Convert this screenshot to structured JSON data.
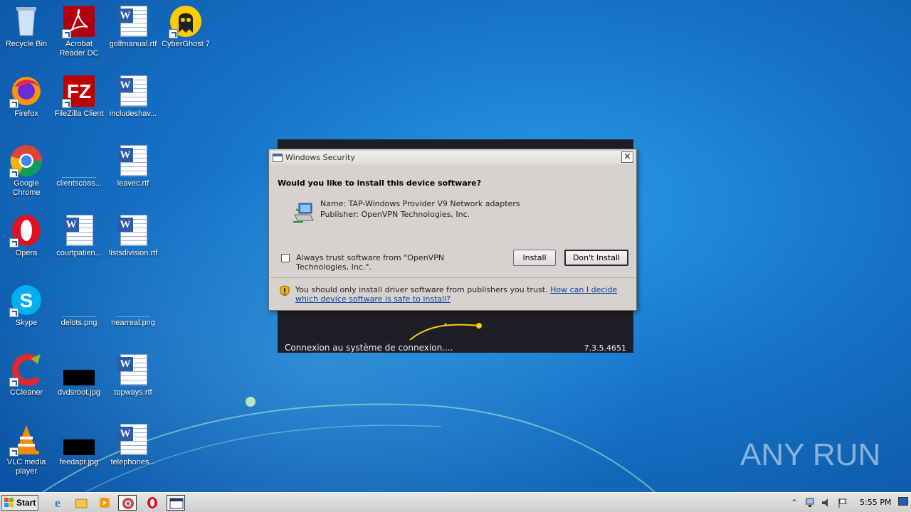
{
  "desktop_icons": [
    {
      "label": "Recycle Bin",
      "icon": "recycle-bin-icon"
    },
    {
      "label": "Acrobat Reader DC",
      "icon": "acrobat-icon"
    },
    {
      "label": "golfmanual.rtf",
      "icon": "word-document-icon"
    },
    {
      "label": "CyberGhost 7",
      "icon": "cyberghost-icon"
    },
    {
      "label": "Firefox",
      "icon": "firefox-icon"
    },
    {
      "label": "FileZilla Client",
      "icon": "filezilla-icon"
    },
    {
      "label": "includeshav...",
      "icon": "word-document-icon"
    },
    {
      "label": "Google Chrome",
      "icon": "chrome-icon"
    },
    {
      "label": "clientscoas...",
      "icon": "blank-file-icon"
    },
    {
      "label": "leavec.rtf",
      "icon": "word-document-icon"
    },
    {
      "label": "Opera",
      "icon": "opera-icon"
    },
    {
      "label": "courtpatien...",
      "icon": "word-document-icon"
    },
    {
      "label": "listsdivision.rtf",
      "icon": "word-document-icon"
    },
    {
      "label": "Skype",
      "icon": "skype-icon"
    },
    {
      "label": "delots.png",
      "icon": "image-file-icon"
    },
    {
      "label": "nearreal.png",
      "icon": "image-file-icon"
    },
    {
      "label": "CCleaner",
      "icon": "ccleaner-icon"
    },
    {
      "label": "dvdsroot.jpg",
      "icon": "image-file-icon"
    },
    {
      "label": "topways.rtf",
      "icon": "word-document-icon"
    },
    {
      "label": "VLC media player",
      "icon": "vlc-icon"
    },
    {
      "label": "feedapr.jpg",
      "icon": "image-file-icon"
    },
    {
      "label": "telephones...",
      "icon": "word-document-icon"
    }
  ],
  "vpn_window": {
    "status": "Connexion au système de connexion....",
    "version": "7.3.5.4651"
  },
  "dialog": {
    "title": "Windows Security",
    "close_label": "✕",
    "question": "Would you like to install this device software?",
    "device_name": "Name: TAP-Windows Provider V9 Network adapters",
    "device_publisher": "Publisher: OpenVPN Technologies, Inc.",
    "trust_label": "Always trust software from \"OpenVPN Technologies, Inc.\".",
    "trust_checked": false,
    "install_label": "Install",
    "dont_install_label": "Don't Install",
    "warning_text": "You should only install driver software from publishers you trust. ",
    "warning_link": "How can I decide which device software is safe to install?"
  },
  "taskbar": {
    "start_label": "Start",
    "pinned": [
      "internet-explorer-icon",
      "explorer-folder-icon",
      "media-player-icon",
      "chrome-icon",
      "opera-icon",
      "security-dialog-icon"
    ],
    "tray": [
      "show-hidden-icons-icon",
      "network-icon",
      "volume-icon",
      "action-center-flag-icon"
    ],
    "clock": "5:55 PM"
  },
  "watermark": {
    "text": "ANY RUN"
  },
  "colors": {
    "desktop": "#1673c8",
    "dialog_bg": "#d6d3ce",
    "link": "#0b3fa6"
  }
}
